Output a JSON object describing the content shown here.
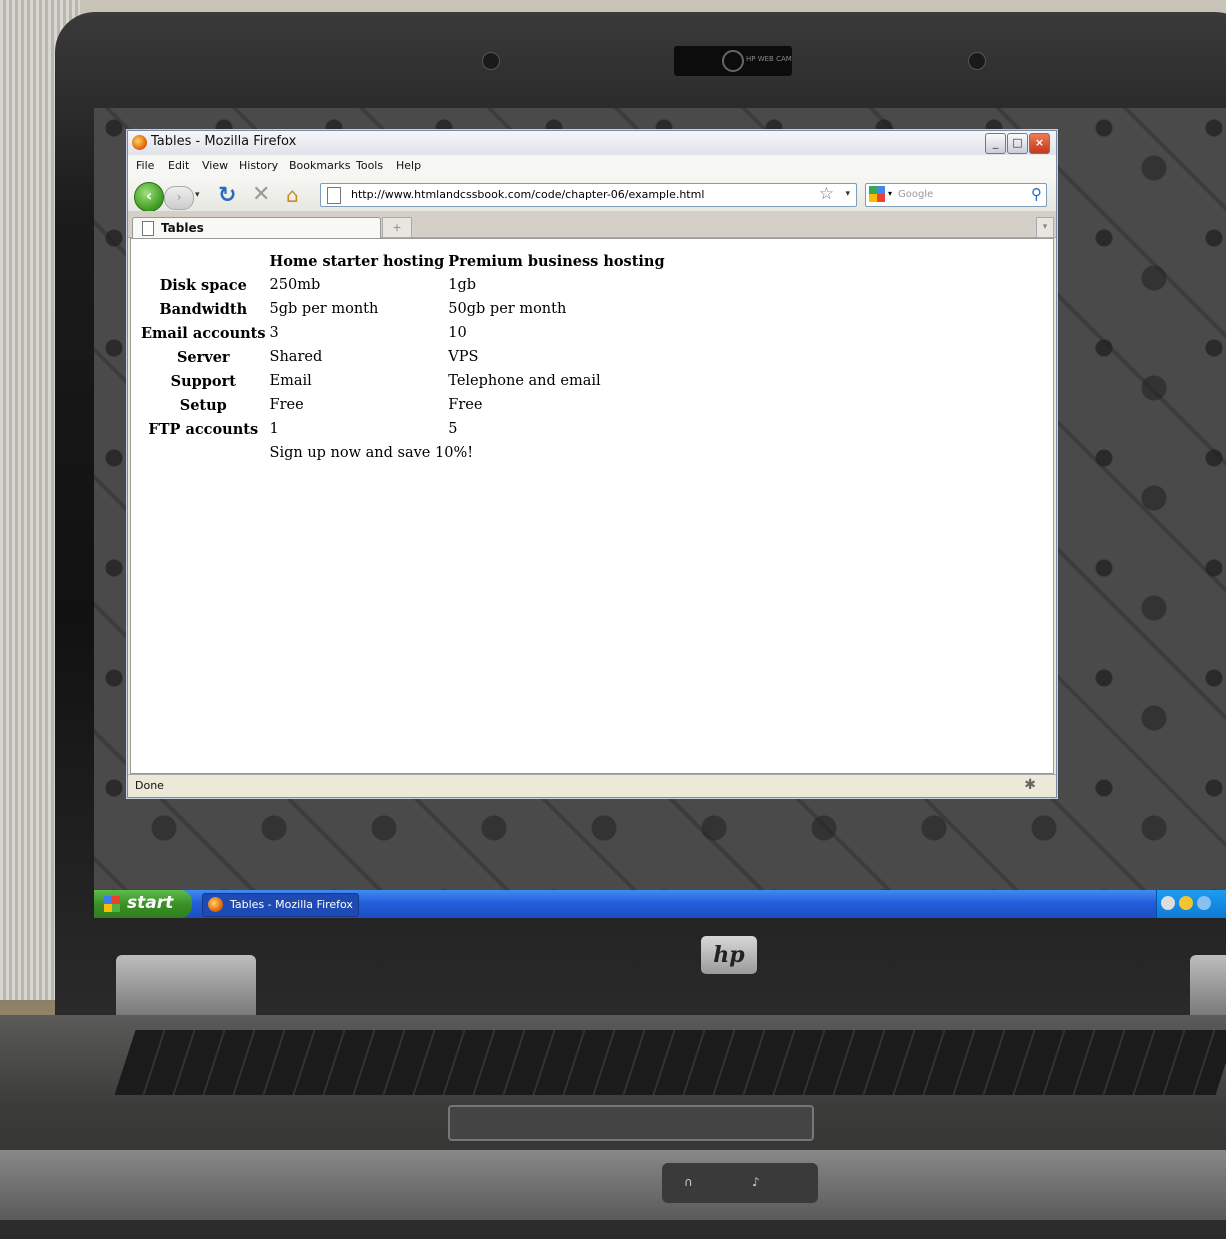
{
  "browser": {
    "window_title": "Tables - Mozilla Firefox",
    "menu": [
      "File",
      "Edit",
      "View",
      "History",
      "Bookmarks",
      "Tools",
      "Help"
    ],
    "url": "http://www.htmlandcssbook.com/code/chapter-06/example.html",
    "search_placeholder": "Google",
    "tab_label": "Tables",
    "new_tab_label": "+",
    "status": "Done",
    "icons": [
      "firefox-icon",
      "back-icon",
      "forward-icon",
      "reload-icon",
      "stop-icon",
      "home-icon",
      "page-icon",
      "star-icon",
      "search-icon"
    ]
  },
  "table": {
    "headers": [
      "",
      "Home starter hosting",
      "Premium business hosting"
    ],
    "rows": [
      {
        "label": "Disk space",
        "home": "250mb",
        "premium": "1gb"
      },
      {
        "label": "Bandwidth",
        "home": "5gb per month",
        "premium": "50gb per month"
      },
      {
        "label": "Email accounts",
        "home": "3",
        "premium": "10"
      },
      {
        "label": "Server",
        "home": "Shared",
        "premium": "VPS"
      },
      {
        "label": "Support",
        "home": "Email",
        "premium": "Telephone and email"
      },
      {
        "label": "Setup",
        "home": "Free",
        "premium": "Free"
      },
      {
        "label": "FTP accounts",
        "home": "1",
        "premium": "5"
      }
    ],
    "footer": "Sign up now and save 10%!"
  },
  "taskbar": {
    "start_label": "start",
    "task_label": "Tables - Mozilla Firefox"
  },
  "hardware": {
    "webcam_label": "HP WEB CAM",
    "logo": "hp"
  },
  "colors": {
    "xp_taskbar": "#245edb",
    "start_green": "#3a9128",
    "title_close": "#c2381a"
  }
}
